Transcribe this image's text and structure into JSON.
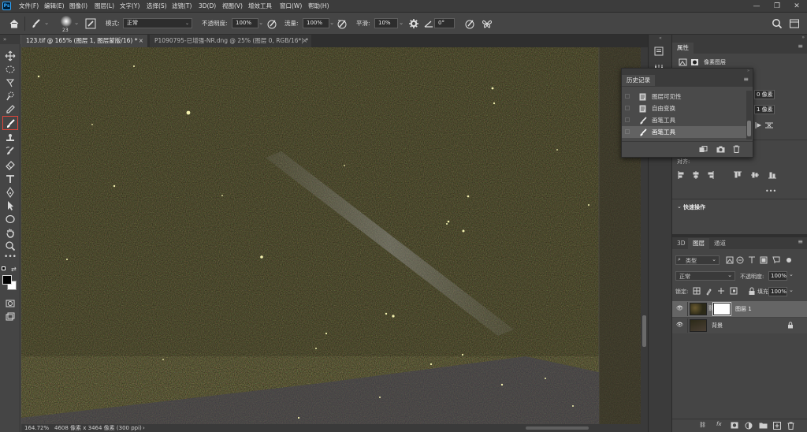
{
  "app": {
    "name": "Photoshop",
    "logo_text": "Ps"
  },
  "menu": [
    "文件(F)",
    "编辑(E)",
    "图像(I)",
    "图层(L)",
    "文字(Y)",
    "选择(S)",
    "滤镜(T)",
    "3D(D)",
    "视图(V)",
    "增效工具",
    "窗口(W)",
    "帮助(H)"
  ],
  "window_controls": {
    "minimize": "—",
    "restore": "❐",
    "close": "✕"
  },
  "options_bar": {
    "brush_size": "23",
    "mode_label": "模式:",
    "mode_value": "正常",
    "opacity_label": "不透明度:",
    "opacity_value": "100%",
    "flow_label": "流量:",
    "flow_value": "100%",
    "smoothing_label": "平滑:",
    "smoothing_value": "10%",
    "angle_value": "0°"
  },
  "tabs": [
    {
      "label": "123.tif @ 165% (图层 1, 图层蒙版/16) *",
      "active": true,
      "close": "×"
    },
    {
      "label": "P1090795-已增强-NR.dng @ 25% (图层 0, RGB/16*) *",
      "active": false,
      "close": "×"
    }
  ],
  "status": {
    "zoom": "164.72%",
    "doc_info": "4608 像素 x 3464 像素 (300 ppi)",
    "arrow": "›"
  },
  "properties_panel": {
    "title": "属性",
    "subtitle": "像素图层",
    "w_value": "0 像素",
    "h_value": "1 像素",
    "align_label": "对齐:",
    "more": "•••",
    "quick_actions": "快速操作"
  },
  "history_panel": {
    "title": "历史记录",
    "items": [
      {
        "label": "图层可见性",
        "icon": "doc-icon",
        "selected": false
      },
      {
        "label": "自由变换",
        "icon": "doc-icon",
        "selected": false
      },
      {
        "label": "画笔工具",
        "icon": "brush-icon",
        "selected": false
      },
      {
        "label": "画笔工具",
        "icon": "brush-icon",
        "selected": true
      }
    ]
  },
  "layers_panel": {
    "tabs": [
      "3D",
      "图层",
      "通道"
    ],
    "active_tab": "图层",
    "filter_label": "类型",
    "blend_mode": "正常",
    "opacity_label": "不透明度:",
    "opacity_value": "100%",
    "lock_label": "锁定:",
    "fill_label": "填充:",
    "fill_value": "100%",
    "layers": [
      {
        "name": "图层 1",
        "visible": true,
        "selected": true,
        "has_mask": true
      },
      {
        "name": "背景",
        "visible": true,
        "selected": false,
        "locked": true
      }
    ]
  },
  "colors": {
    "accent": "#31a8ff",
    "selected_tool_border": "#e0453a",
    "canvas_bg": "#2c2a18"
  }
}
